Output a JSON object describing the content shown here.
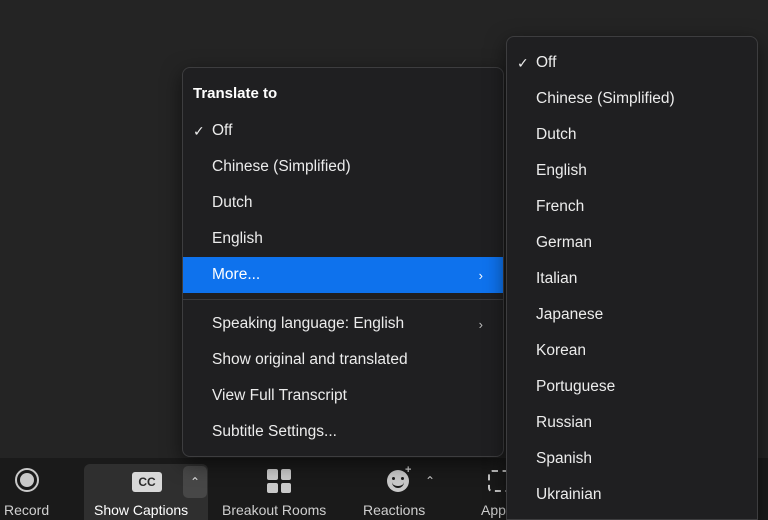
{
  "translate_menu": {
    "header": "Translate to",
    "check_glyph": "✓",
    "chevron_glyph": "›",
    "items": [
      {
        "label": "Off",
        "checked": true
      },
      {
        "label": "Chinese (Simplified)"
      },
      {
        "label": "Dutch"
      },
      {
        "label": "English"
      },
      {
        "label": "More...",
        "highlighted": true,
        "submenu": true
      }
    ],
    "options": [
      {
        "label": "Speaking language: English",
        "submenu": true
      },
      {
        "label": "Show original and translated"
      },
      {
        "label": "View Full Transcript"
      },
      {
        "label": "Subtitle Settings..."
      }
    ]
  },
  "language_submenu": {
    "items": [
      {
        "label": "Off",
        "checked": true
      },
      {
        "label": "Chinese (Simplified)"
      },
      {
        "label": "Dutch"
      },
      {
        "label": "English"
      },
      {
        "label": "French"
      },
      {
        "label": "German"
      },
      {
        "label": "Italian"
      },
      {
        "label": "Japanese"
      },
      {
        "label": "Korean"
      },
      {
        "label": "Portuguese"
      },
      {
        "label": "Russian"
      },
      {
        "label": "Spanish"
      },
      {
        "label": "Ukrainian"
      }
    ]
  },
  "toolbar": {
    "record_label": "Record",
    "captions_label": "Show Captions",
    "captions_icon_text": "CC",
    "caret_glyph": "⌃",
    "breakout_label": "Breakout Rooms",
    "reactions_label": "Reactions",
    "reactions_plus": "+",
    "apps_label": "Apps"
  },
  "colors": {
    "highlight": "#0e72ed",
    "menu_bg": "#1f1f21",
    "toolbar_bg": "#1a1a1a"
  }
}
